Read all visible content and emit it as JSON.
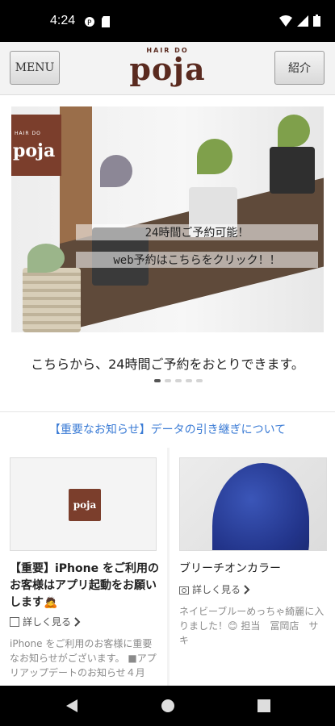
{
  "status": {
    "time": "4:24"
  },
  "header": {
    "menu_label": "MENU",
    "intro_label": "紹介",
    "logo_small": "HAIR DO",
    "logo_big": "poja"
  },
  "carousel": {
    "photo_logo_small": "HAIR DO",
    "photo_logo_big": "poja",
    "overlay_line1": "24時間ご予約可能！",
    "overlay_line2": "web予約はこちらをクリック！！",
    "caption": "こちらから、24時間ご予約をおとりできます。",
    "slide_count": 5,
    "active_slide": 1
  },
  "notice": "【重要なお知らせ】データの引き継ぎについて",
  "cards": [
    {
      "thumb_logo": "poja",
      "title": "【重要】iPhone をご利用のお客様はアプリ起動をお願いします🙇",
      "more": "詳しく見る",
      "desc": "iPhone をご利用のお客様に重要なお知らせがございます。 ■アプリアップデートのお知らせ４月"
    },
    {
      "title": "ブリーチオンカラー",
      "more": "詳しく見る",
      "desc": "ネイビーブルーめっちゃ綺麗に入りました！😊 担当　冨岡店　サキ"
    }
  ],
  "colors": {
    "brand": "#7b3e2c",
    "link": "#3a7bd5"
  }
}
